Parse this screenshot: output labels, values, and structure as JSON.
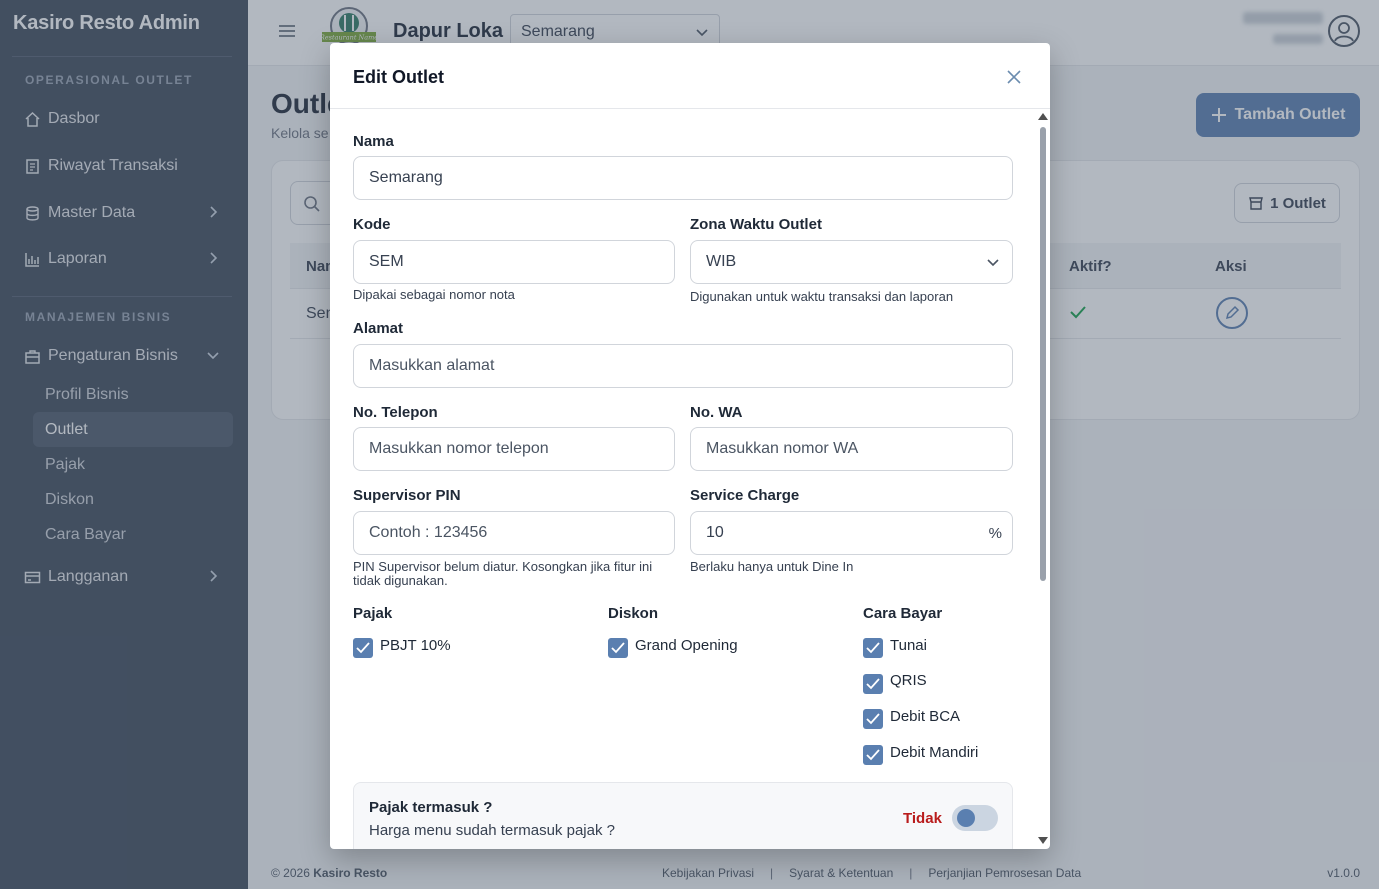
{
  "app": {
    "brand": "Kasiro Resto Admin"
  },
  "sidebar": {
    "section_ops": "OPERASIONAL OUTLET",
    "section_biz": "MANAJEMEN BISNIS",
    "items": [
      "Dasbor",
      "Riwayat Transaksi",
      "Master Data",
      "Laporan"
    ],
    "biz_group": "Pengaturan Bisnis",
    "sub_items": [
      "Profil Bisnis",
      "Outlet",
      "Pajak",
      "Diskon",
      "Cara Bayar"
    ],
    "subscription": "Langganan"
  },
  "header": {
    "logo_text": "Restaurant Name",
    "business_name": "Dapur Loka",
    "outlet_selected": "Semarang"
  },
  "main": {
    "title": "Outlet",
    "subtitle": "Kelola se",
    "add_button": "Tambah Outlet",
    "count_badge": "1 Outlet",
    "columns": [
      "Nam",
      "Aktif?",
      "Aksi"
    ],
    "row_name": "Sem"
  },
  "footer": {
    "copy_prefix": "© 2026",
    "copy_brand": "Kasiro Resto",
    "links": [
      "Kebijakan Privasi",
      "Syarat & Ketentuan",
      "Perjanjian Pemrosesan Data"
    ],
    "version": "v1.0.0"
  },
  "modal": {
    "title": "Edit Outlet",
    "nama_label": "Nama",
    "nama_value": "Semarang",
    "kode_label": "Kode",
    "kode_value": "SEM",
    "kode_hint": "Dipakai sebagai nomor nota",
    "zona_label": "Zona Waktu Outlet",
    "zona_value": "WIB",
    "zona_hint": "Digunakan untuk waktu transaksi dan laporan",
    "alamat_label": "Alamat",
    "alamat_placeholder": "Masukkan alamat",
    "telp_label": "No. Telepon",
    "telp_placeholder": "Masukkan nomor telepon",
    "wa_label": "No. WA",
    "wa_placeholder": "Masukkan nomor WA",
    "pin_label": "Supervisor PIN",
    "pin_placeholder": "Contoh : 123456",
    "pin_hint": "PIN Supervisor belum diatur. Kosongkan jika fitur ini tidak digunakan.",
    "sc_label": "Service Charge",
    "sc_value": "10",
    "sc_unit": "%",
    "sc_hint": "Berlaku hanya untuk Dine In",
    "pajak_label": "Pajak",
    "pajak_items": [
      "PBJT 10%"
    ],
    "diskon_label": "Diskon",
    "diskon_items": [
      "Grand Opening"
    ],
    "bayar_label": "Cara Bayar",
    "bayar_items": [
      "Tunai",
      "QRIS",
      "Debit BCA",
      "Debit Mandiri"
    ],
    "toggle_title": "Pajak termasuk ?",
    "toggle_sub": "Harga menu sudah termasuk pajak ?",
    "toggle_state": "Tidak"
  },
  "colors": {
    "accent": "#5a7fb0",
    "sidebar": "#3f4a5b",
    "danger": "#b91c1c"
  }
}
